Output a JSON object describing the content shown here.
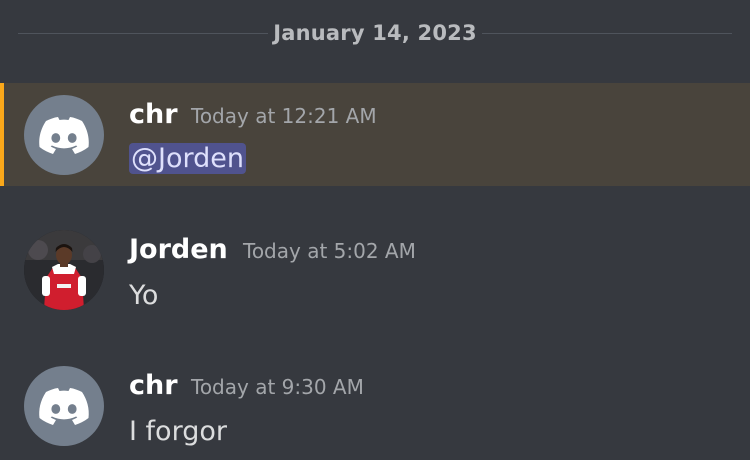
{
  "date_divider": "January 14, 2023",
  "messages": [
    {
      "author": "chr",
      "timestamp": "Today at 12:21 AM",
      "content": "@Jorden",
      "avatar_icon": "discord-logo-icon",
      "mentioned": true
    },
    {
      "author": "Jorden",
      "timestamp": "Today at 5:02 AM",
      "content": "Yo",
      "avatar_icon": "profile-photo"
    },
    {
      "author": "chr",
      "timestamp": "Today at 9:30 AM",
      "content": "I forgor",
      "avatar_icon": "discord-logo-icon"
    }
  ],
  "colors": {
    "background": "#36393f",
    "mention_highlight": "#49443c",
    "mention_bar": "#faa81a",
    "mention_pill": "#5865f2",
    "default_avatar": "#747f8d"
  }
}
